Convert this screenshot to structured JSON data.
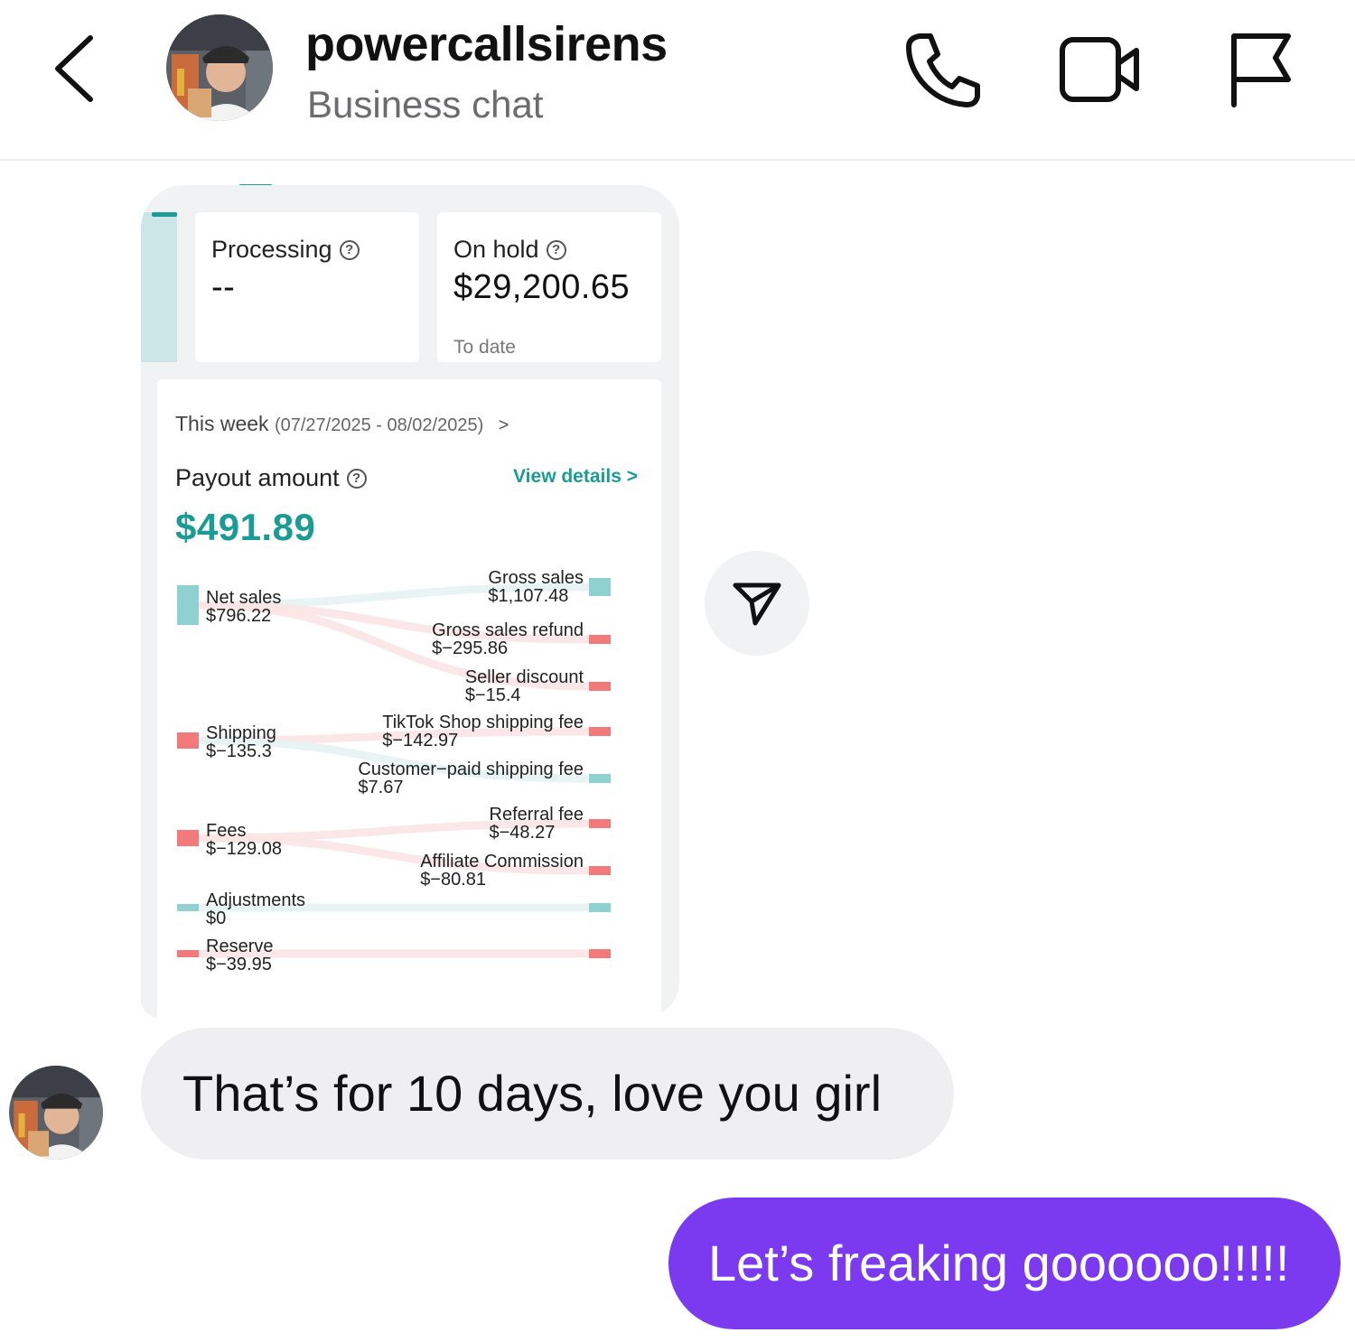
{
  "header": {
    "back_icon": "chevron-left-icon",
    "username": "powercallsirens",
    "subtitle": "Business chat",
    "actions": [
      "phone-icon",
      "video-camera-icon",
      "flag-icon"
    ]
  },
  "shared_card": {
    "processing": {
      "label": "Processing",
      "value": "--"
    },
    "on_hold": {
      "label": "On hold",
      "value": "$29,200.65",
      "sub": "To date"
    },
    "week": {
      "label": "This week",
      "range": "(07/27/2025 - 08/02/2025)",
      "chevron": ">"
    },
    "payout": {
      "label": "Payout amount",
      "link": "View details",
      "link_chevron": ">",
      "amount": "$491.89"
    },
    "colors": {
      "accent": "#1a9c95",
      "positive": "#8fd0d0",
      "negative": "#f27a7a"
    }
  },
  "chart_data": {
    "type": "sankey",
    "sources": [
      {
        "label": "Net sales",
        "value": "$796.22",
        "sign": "positive"
      },
      {
        "label": "Shipping",
        "value": "$−135.3",
        "sign": "negative"
      },
      {
        "label": "Fees",
        "value": "$−129.08",
        "sign": "negative"
      },
      {
        "label": "Adjustments",
        "value": "$0",
        "sign": "positive"
      },
      {
        "label": "Reserve",
        "value": "$−39.95",
        "sign": "negative"
      }
    ],
    "targets": [
      {
        "label": "Gross sales",
        "value": "$1,107.48",
        "source": 0,
        "sign": "positive"
      },
      {
        "label": "Gross sales refund",
        "value": "$−295.86",
        "source": 0,
        "sign": "negative"
      },
      {
        "label": "Seller discount",
        "value": "$−15.4",
        "source": 0,
        "sign": "negative"
      },
      {
        "label": "TikTok Shop shipping fee",
        "value": "$−142.97",
        "source": 1,
        "sign": "negative"
      },
      {
        "label": "Customer−paid shipping fee",
        "value": "$7.67",
        "source": 1,
        "sign": "positive"
      },
      {
        "label": "Referral fee",
        "value": "$−48.27",
        "source": 2,
        "sign": "negative"
      },
      {
        "label": "Affiliate Commission",
        "value": "$−80.81",
        "source": 2,
        "sign": "negative"
      },
      {
        "label": "",
        "value": "",
        "source": 3,
        "sign": "positive"
      },
      {
        "label": "",
        "value": "",
        "source": 4,
        "sign": "negative"
      }
    ]
  },
  "forward_icon": "send-icon",
  "messages": [
    {
      "direction": "incoming",
      "text": "That’s for 10 days, love you girl"
    },
    {
      "direction": "outgoing",
      "text": "Let’s freaking goooooo!!!!!"
    }
  ]
}
